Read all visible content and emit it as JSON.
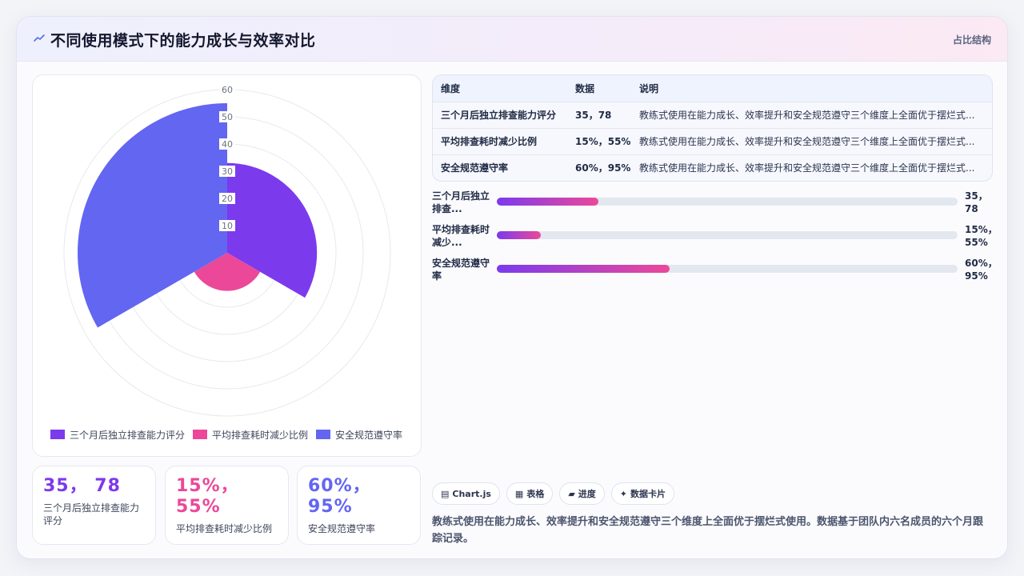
{
  "header": {
    "title": "不同使用模式下的能力成长与效率对比",
    "tag": "占比结构"
  },
  "colors": {
    "purple": "#7c3aed",
    "pink": "#ec4899",
    "indigo": "#6366f1"
  },
  "chart_data": {
    "type": "polarArea",
    "categories": [
      "三个月后独立排查能力评分",
      "平均排查耗时减少比例",
      "安全规范遵守率"
    ],
    "values": [
      33,
      14,
      55
    ],
    "colors": [
      "#7c3aed",
      "#ec4899",
      "#6366f1"
    ],
    "radial_ticks": [
      "10",
      "20",
      "30",
      "40",
      "50",
      "60"
    ],
    "r_max": 60,
    "grid": true,
    "legend_position": "bottom"
  },
  "stats": [
    {
      "value": "35， 78",
      "label": "三个月后独立排查能力评分",
      "color": "#7c3aed"
    },
    {
      "value": "15%， 55%",
      "label": "平均排查耗时减少比例",
      "color": "#ec4899"
    },
    {
      "value": "60%， 95%",
      "label": "安全规范遵守率",
      "color": "#6366f1"
    }
  ],
  "table": {
    "headers": [
      "维度",
      "数据",
      "说明"
    ],
    "rows": [
      {
        "dim": "三个月后独立排查能力评分",
        "data": "35，78",
        "desc": "教练式使用在能力成长、效率提升和安全规范遵守三个维度上全面优于摆烂式..."
      },
      {
        "dim": "平均排查耗时减少比例",
        "data": "15%，55%",
        "desc": "教练式使用在能力成长、效率提升和安全规范遵守三个维度上全面优于摆烂式..."
      },
      {
        "dim": "安全规范遵守率",
        "data": "60%，95%",
        "desc": "教练式使用在能力成长、效率提升和安全规范遵守三个维度上全面优于摆烂式..."
      }
    ]
  },
  "progress": [
    {
      "label": "三个月后独立排查...",
      "value": "35， 78",
      "fill": 0.22
    },
    {
      "label": "平均排查耗时减少...",
      "value": "15%， 55%",
      "fill": 0.095
    },
    {
      "label": "安全规范遵守率",
      "value": "60%， 95%",
      "fill": 0.375
    }
  ],
  "chips": [
    {
      "icon": "▤",
      "label": "Chart.js",
      "icon_name": "chart-icon"
    },
    {
      "icon": "▦",
      "label": "表格",
      "icon_name": "table-icon"
    },
    {
      "icon": "▰",
      "label": "进度",
      "icon_name": "progress-icon"
    },
    {
      "icon": "✦",
      "label": "数据卡片",
      "icon_name": "card-icon"
    }
  ],
  "note": "教练式使用在能力成长、效率提升和安全规范遵守三个维度上全面优于摆烂式使用。数据基于团队内六名成员的六个月跟踪记录。"
}
